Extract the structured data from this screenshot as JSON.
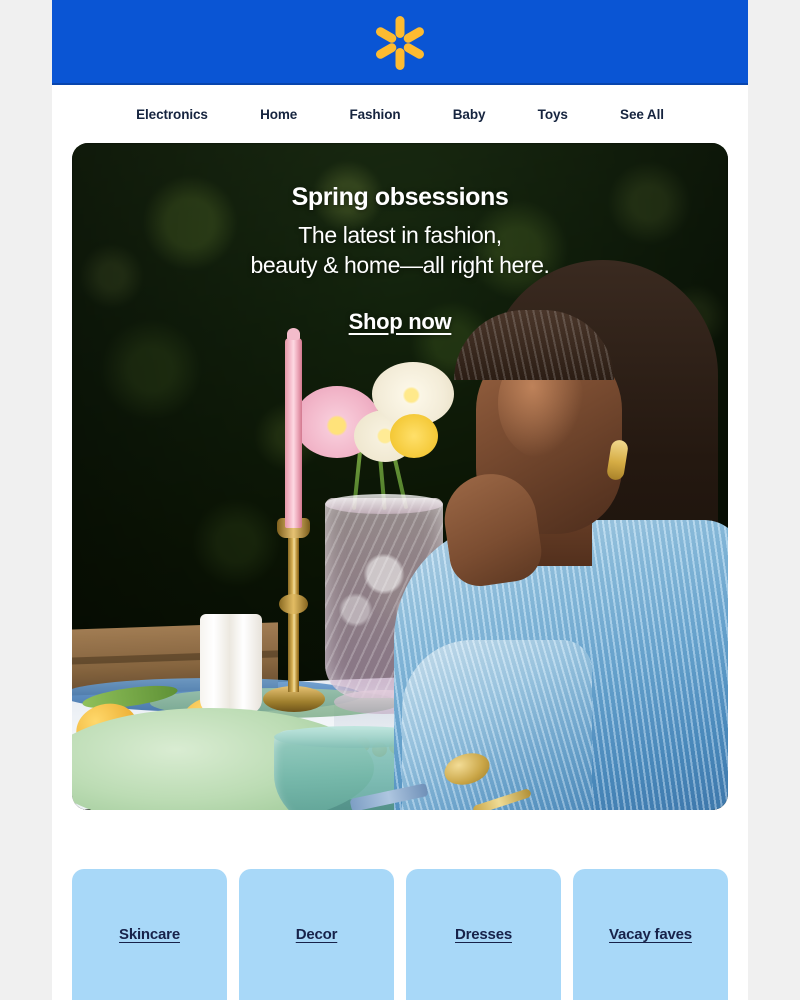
{
  "header": {
    "logo_name": "walmart-spark-logo",
    "background_color": "#0a55d4",
    "logo_color": "#fdbb30"
  },
  "nav": {
    "items": [
      {
        "label": "Electronics"
      },
      {
        "label": "Home"
      },
      {
        "label": "Fashion"
      },
      {
        "label": "Baby"
      },
      {
        "label": "Toys"
      },
      {
        "label": "See All"
      }
    ]
  },
  "hero": {
    "title": "Spring obsessions",
    "subtitle_line1": "The latest in fashion,",
    "subtitle_line2": "beauty & home—all right here.",
    "cta_label": "Shop now",
    "scene_description": "Woman in light blue pleated blouse at outdoor table with flowers, candle and lemons"
  },
  "tiles": [
    {
      "label": "Skincare"
    },
    {
      "label": "Decor"
    },
    {
      "label": "Dresses"
    },
    {
      "label": "Vacay faves"
    }
  ],
  "colors": {
    "page_background": "#f0f0f0",
    "body_background": "#ffffff",
    "brand_blue": "#0a55d4",
    "brand_yellow": "#fdbb30",
    "nav_text": "#16243f",
    "tile_background": "#a8d8f8",
    "tile_link": "#17224a"
  }
}
